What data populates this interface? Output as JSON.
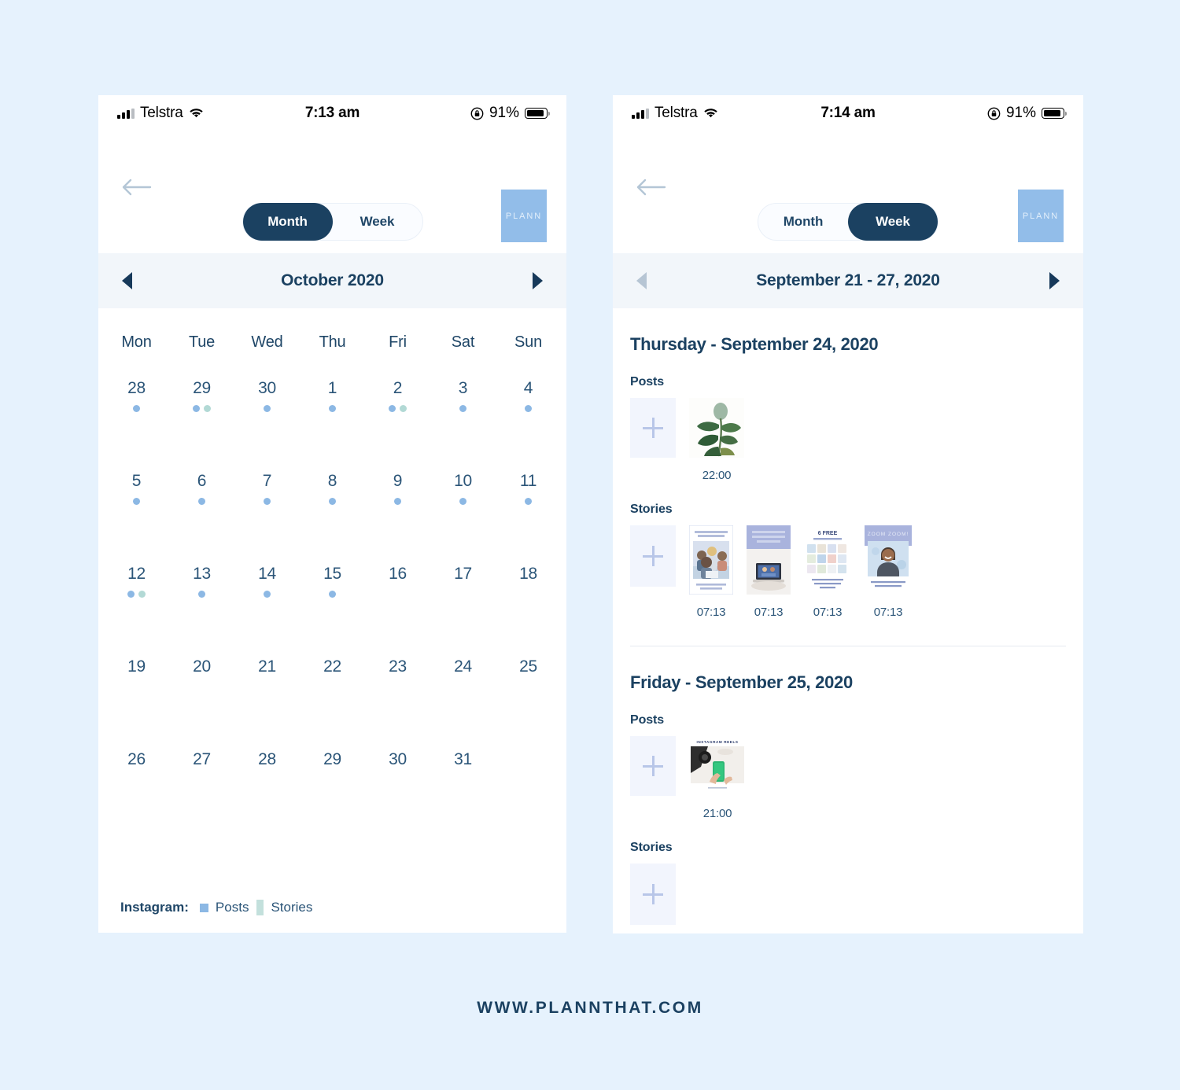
{
  "footer": {
    "url": "WWW.PLANNTHAT.COM"
  },
  "colors": {
    "page_background": "#e6f2fd",
    "navy": "#1b4161",
    "post_dot": "#8cb8e4",
    "story_dot": "#b2d9d5",
    "logo_blue": "#92bde9",
    "tile_placeholder": "#f2f5fd"
  },
  "phone_left": {
    "status_bar": {
      "carrier": "Telstra",
      "time": "7:13 am",
      "battery_percent": "91%",
      "signal_icon": "signal-bars-icon",
      "wifi_icon": "wifi-icon",
      "rotation_lock_icon": "rotation-lock-icon",
      "battery_icon": "battery-icon"
    },
    "nav": {
      "back_icon": "back-arrow-icon",
      "logo_text": "PLANN"
    },
    "view_toggle": {
      "options": [
        "Month",
        "Week"
      ],
      "selected": "Month"
    },
    "date_bar": {
      "prev_icon": "chevron-left-icon",
      "title": "October 2020",
      "next_icon": "chevron-right-icon"
    },
    "day_headers": [
      "Mon",
      "Tue",
      "Wed",
      "Thu",
      "Fri",
      "Sat",
      "Sun"
    ],
    "weeks": [
      [
        {
          "day": "28",
          "posts": 1,
          "stories": 0
        },
        {
          "day": "29",
          "posts": 1,
          "stories": 1
        },
        {
          "day": "30",
          "posts": 1,
          "stories": 0
        },
        {
          "day": "1",
          "posts": 1,
          "stories": 0
        },
        {
          "day": "2",
          "posts": 1,
          "stories": 1
        },
        {
          "day": "3",
          "posts": 1,
          "stories": 0
        },
        {
          "day": "4",
          "posts": 1,
          "stories": 0
        }
      ],
      [
        {
          "day": "5",
          "posts": 1,
          "stories": 0
        },
        {
          "day": "6",
          "posts": 1,
          "stories": 0
        },
        {
          "day": "7",
          "posts": 1,
          "stories": 0
        },
        {
          "day": "8",
          "posts": 1,
          "stories": 0
        },
        {
          "day": "9",
          "posts": 1,
          "stories": 0
        },
        {
          "day": "10",
          "posts": 1,
          "stories": 0
        },
        {
          "day": "11",
          "posts": 1,
          "stories": 0
        }
      ],
      [
        {
          "day": "12",
          "posts": 1,
          "stories": 1
        },
        {
          "day": "13",
          "posts": 1,
          "stories": 0
        },
        {
          "day": "14",
          "posts": 1,
          "stories": 0
        },
        {
          "day": "15",
          "posts": 1,
          "stories": 0
        },
        {
          "day": "16",
          "posts": 0,
          "stories": 0
        },
        {
          "day": "17",
          "posts": 0,
          "stories": 0
        },
        {
          "day": "18",
          "posts": 0,
          "stories": 0
        }
      ],
      [
        {
          "day": "19",
          "posts": 0,
          "stories": 0
        },
        {
          "day": "20",
          "posts": 0,
          "stories": 0
        },
        {
          "day": "21",
          "posts": 0,
          "stories": 0
        },
        {
          "day": "22",
          "posts": 0,
          "stories": 0
        },
        {
          "day": "23",
          "posts": 0,
          "stories": 0
        },
        {
          "day": "24",
          "posts": 0,
          "stories": 0
        },
        {
          "day": "25",
          "posts": 0,
          "stories": 0
        }
      ],
      [
        {
          "day": "26",
          "posts": 0,
          "stories": 0
        },
        {
          "day": "27",
          "posts": 0,
          "stories": 0
        },
        {
          "day": "28",
          "posts": 0,
          "stories": 0
        },
        {
          "day": "29",
          "posts": 0,
          "stories": 0
        },
        {
          "day": "30",
          "posts": 0,
          "stories": 0
        },
        {
          "day": "31",
          "posts": 0,
          "stories": 0
        },
        {
          "day": "",
          "posts": 0,
          "stories": 0
        }
      ]
    ],
    "legend": {
      "label": "Instagram:",
      "items": [
        {
          "name": "Posts",
          "swatch": "post-swatch"
        },
        {
          "name": "Stories",
          "swatch": "story-swatch"
        }
      ]
    }
  },
  "phone_right": {
    "status_bar": {
      "carrier": "Telstra",
      "time": "7:14 am",
      "battery_percent": "91%",
      "signal_icon": "signal-bars-icon",
      "wifi_icon": "wifi-icon",
      "rotation_lock_icon": "rotation-lock-icon",
      "battery_icon": "battery-icon"
    },
    "nav": {
      "back_icon": "back-arrow-icon",
      "logo_text": "PLANN"
    },
    "view_toggle": {
      "options": [
        "Month",
        "Week"
      ],
      "selected": "Week"
    },
    "date_bar": {
      "prev_icon": "chevron-left-icon",
      "title": "September 21 - 27, 2020",
      "next_icon": "chevron-right-icon"
    },
    "days": [
      {
        "title": "Thursday - September 24, 2020",
        "posts_label": "Posts",
        "posts": [
          {
            "time": "22:00",
            "media": "plant-photo"
          }
        ],
        "stories_label": "Stories",
        "stories": [
          {
            "time": "07:13",
            "media": "family-laptop-story",
            "caption_top": "THE NEW NORMAL: REMOTE WORKING",
            "caption_bottom": "WORKING FROM HOME TIPS"
          },
          {
            "time": "07:13",
            "media": "laptop-desk-story",
            "caption_top": "HOW TO MAKE YOUR ZOOM MEETINGS MORE ENGAGING"
          },
          {
            "time": "07:13",
            "media": "collage-story",
            "caption_top": "6 FREE",
            "caption_sub": "ZOOM BACKGROUNDS",
            "caption_bottom": "GET THE FREE PACK VIA THE LINK IN OUR BIO"
          },
          {
            "time": "07:13",
            "media": "portrait-story",
            "caption_top": "ZOOM ZOOM!",
            "caption_bottom": "EVERY SINGLE THING YOU NEED FOR YOUR NEXT MEETUP"
          }
        ]
      },
      {
        "title": "Friday - September 25, 2020",
        "posts_label": "Posts",
        "posts": [
          {
            "time": "21:00",
            "media": "instagram-reels-photo",
            "caption_top": "INSTAGRAM REELS"
          }
        ],
        "stories_label": "Stories",
        "stories": []
      }
    ]
  }
}
